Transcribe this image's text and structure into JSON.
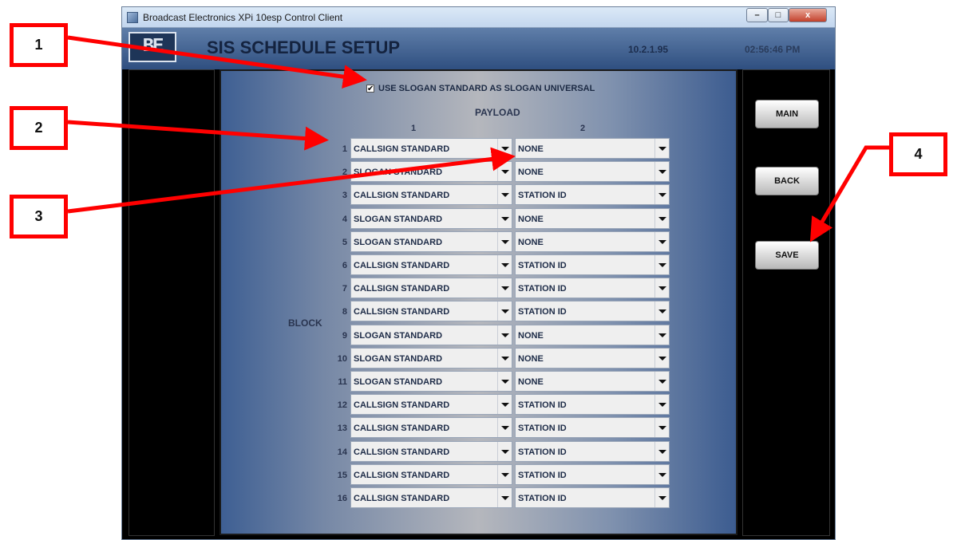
{
  "window": {
    "title": "Broadcast Electronics XPi 10esp Control Client",
    "controls": {
      "minimize": "–",
      "maximize": "□",
      "close": "x"
    }
  },
  "header": {
    "logo": "BE",
    "title": "SIS SCHEDULE SETUP",
    "ip": "10.2.1.95",
    "time": "02:56:46 PM"
  },
  "options": {
    "use_slogan": {
      "label": "USE SLOGAN STANDARD AS SLOGAN UNIVERSAL",
      "checked": true,
      "mark": "✔"
    }
  },
  "table": {
    "payload_label": "PAYLOAD",
    "col1": "1",
    "col2": "2",
    "block_label": "BLOCK",
    "rows": [
      {
        "block": "1",
        "p1": "CALLSIGN STANDARD",
        "p2": "NONE"
      },
      {
        "block": "2",
        "p1": "SLOGAN STANDARD",
        "p2": "NONE"
      },
      {
        "block": "3",
        "p1": "CALLSIGN STANDARD",
        "p2": "STATION ID"
      },
      {
        "block": "4",
        "p1": "SLOGAN STANDARD",
        "p2": "NONE"
      },
      {
        "block": "5",
        "p1": "SLOGAN STANDARD",
        "p2": "NONE"
      },
      {
        "block": "6",
        "p1": "CALLSIGN STANDARD",
        "p2": "STATION ID"
      },
      {
        "block": "7",
        "p1": "CALLSIGN STANDARD",
        "p2": "STATION ID"
      },
      {
        "block": "8",
        "p1": "CALLSIGN STANDARD",
        "p2": "STATION ID"
      },
      {
        "block": "9",
        "p1": "SLOGAN STANDARD",
        "p2": "NONE"
      },
      {
        "block": "10",
        "p1": "SLOGAN STANDARD",
        "p2": "NONE"
      },
      {
        "block": "11",
        "p1": "SLOGAN STANDARD",
        "p2": "NONE"
      },
      {
        "block": "12",
        "p1": "CALLSIGN STANDARD",
        "p2": "STATION ID"
      },
      {
        "block": "13",
        "p1": "CALLSIGN STANDARD",
        "p2": "STATION ID"
      },
      {
        "block": "14",
        "p1": "CALLSIGN STANDARD",
        "p2": "STATION ID"
      },
      {
        "block": "15",
        "p1": "CALLSIGN STANDARD",
        "p2": "STATION ID"
      },
      {
        "block": "16",
        "p1": "CALLSIGN STANDARD",
        "p2": "STATION ID"
      }
    ]
  },
  "buttons": {
    "main": "MAIN",
    "back": "BACK",
    "save": "SAVE"
  },
  "annotations": {
    "c1": "1",
    "c2": "2",
    "c3": "3",
    "c4": "4",
    "color": "#ff0000"
  }
}
